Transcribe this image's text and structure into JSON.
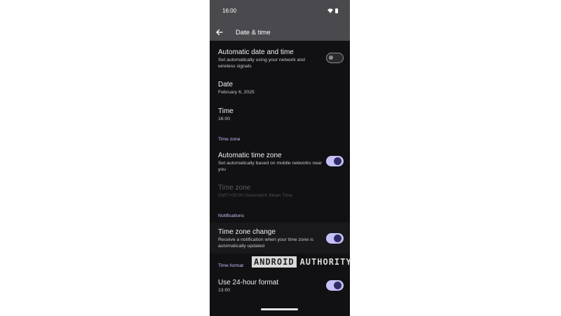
{
  "status_bar": {
    "time": "16:00"
  },
  "app_bar": {
    "title": "Date & time"
  },
  "settings": {
    "automatic_date_time": {
      "title": "Automatic date and time",
      "subtitle": "Set automatically using your network and wireless signals",
      "enabled": false
    },
    "date": {
      "title": "Date",
      "value": "February 6, 2025"
    },
    "time": {
      "title": "Time",
      "value": "16:00"
    },
    "time_zone_section": {
      "header": "Time zone"
    },
    "automatic_time_zone": {
      "title": "Automatic time zone",
      "subtitle": "Set automatically based on mobile networks near you",
      "enabled": true
    },
    "time_zone": {
      "title": "Time zone",
      "value": "GMT+00:00 Greenwich Mean Time",
      "disabled": true
    },
    "notifications_section": {
      "header": "Notifications"
    },
    "time_zone_change": {
      "title": "Time zone change",
      "subtitle": "Receive a notification when your time zone is automatically updated",
      "enabled": true
    },
    "time_format_section": {
      "header": "Time format"
    },
    "use_24_hour": {
      "title": "Use 24-hour format",
      "value": "13:00",
      "enabled": true
    }
  },
  "watermark": {
    "brand_boxed": "ANDROID",
    "brand_text": "AUTHORITY"
  },
  "colors": {
    "accent": "#c5c1f7",
    "section_header": "#c7bfff",
    "background": "#111113",
    "app_bar": "#4a494e"
  },
  "icons": {
    "back": "arrow-left",
    "wifi": "wifi",
    "battery": "battery"
  }
}
